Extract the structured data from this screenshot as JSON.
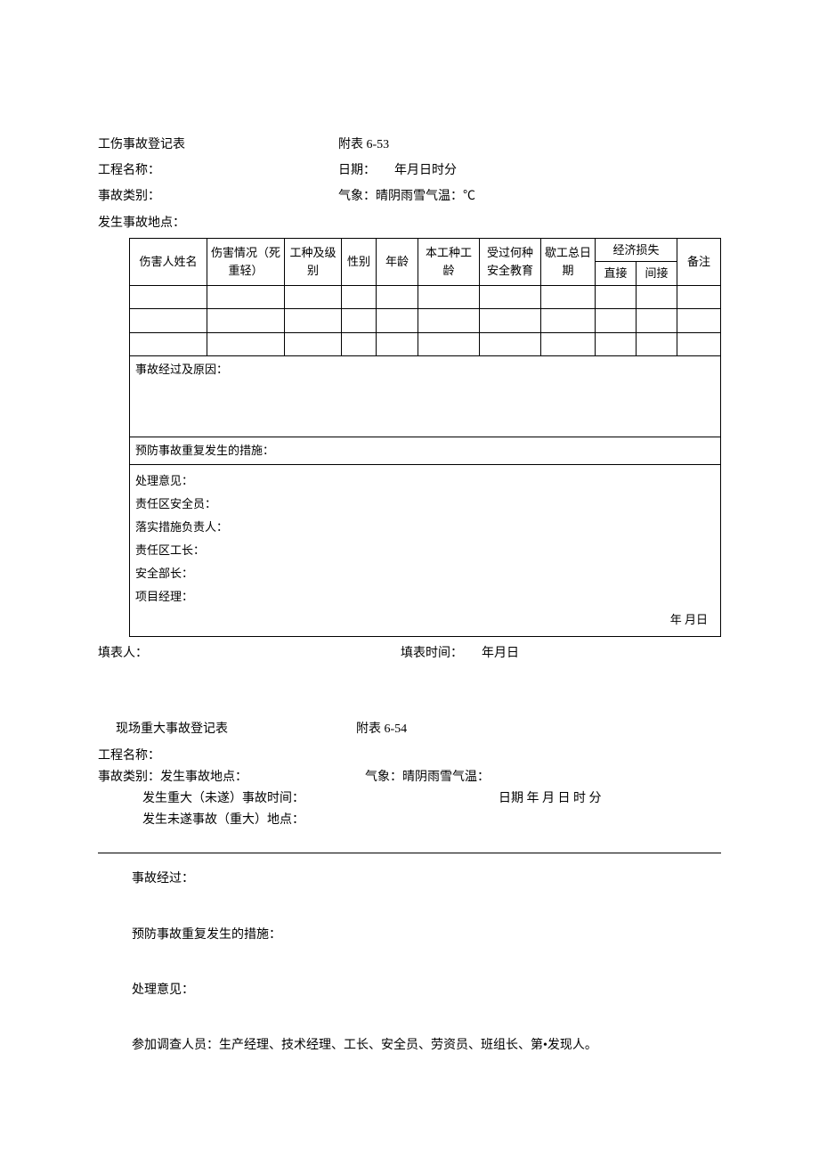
{
  "form1": {
    "title": "工伤事故登记表",
    "appendix": "附表 6-53",
    "project_label": "工程名称：",
    "date_label": "日期：",
    "date_value": "年月日时分",
    "category_label": "事故类别：",
    "weather_label": "气象：晴阴雨雪气温：℃",
    "location_label": "发生事故地点：",
    "headers": {
      "name": "伤害人姓名",
      "injury": "伤害情况（死重轻）",
      "work_type": "工种及级别",
      "gender": "性别",
      "age": "年龄",
      "tenure": "本工种工龄",
      "education": "受过何种安全教育",
      "off_days": "歇工总日期",
      "loss": "经济损失",
      "loss_direct": "直接",
      "loss_indirect": "间接",
      "remark": "备注"
    },
    "sections": {
      "process": "事故经过及原因：",
      "prevention": "预防事故重复发生的措施：",
      "opinion": "处理意见：",
      "safety_officer": "责任区安全员：",
      "measure_owner": "落实措施负责人：",
      "foreman": "责任区工长：",
      "safety_minister": "安全部长：",
      "project_manager": "项目经理：",
      "year_month_day": "年        月日"
    },
    "footer": {
      "filler_label": "填表人：",
      "fill_time_label": "填表时间：",
      "fill_time_value": "年月日"
    }
  },
  "form2": {
    "title": "现场重大事故登记表",
    "appendix": "附表 6-54",
    "project_label": "工程名称：",
    "category_label": "事故类别：发生事故地点：",
    "weather_label": "气象：晴阴雨雪气温：",
    "major_time_label": "发生重大（未遂）事故时间：",
    "date_label": "日期  年  月  日  时  分",
    "near_miss_location_label": "发生未遂事故（重大）地点：",
    "sections": {
      "process": "事故经过：",
      "prevention": "预防事故重复发生的措施：",
      "opinion": "处理意见：",
      "investigators": "参加调查人员：生产经理、技术经理、工长、安全员、劳资员、班组长、第•发现人。"
    }
  }
}
